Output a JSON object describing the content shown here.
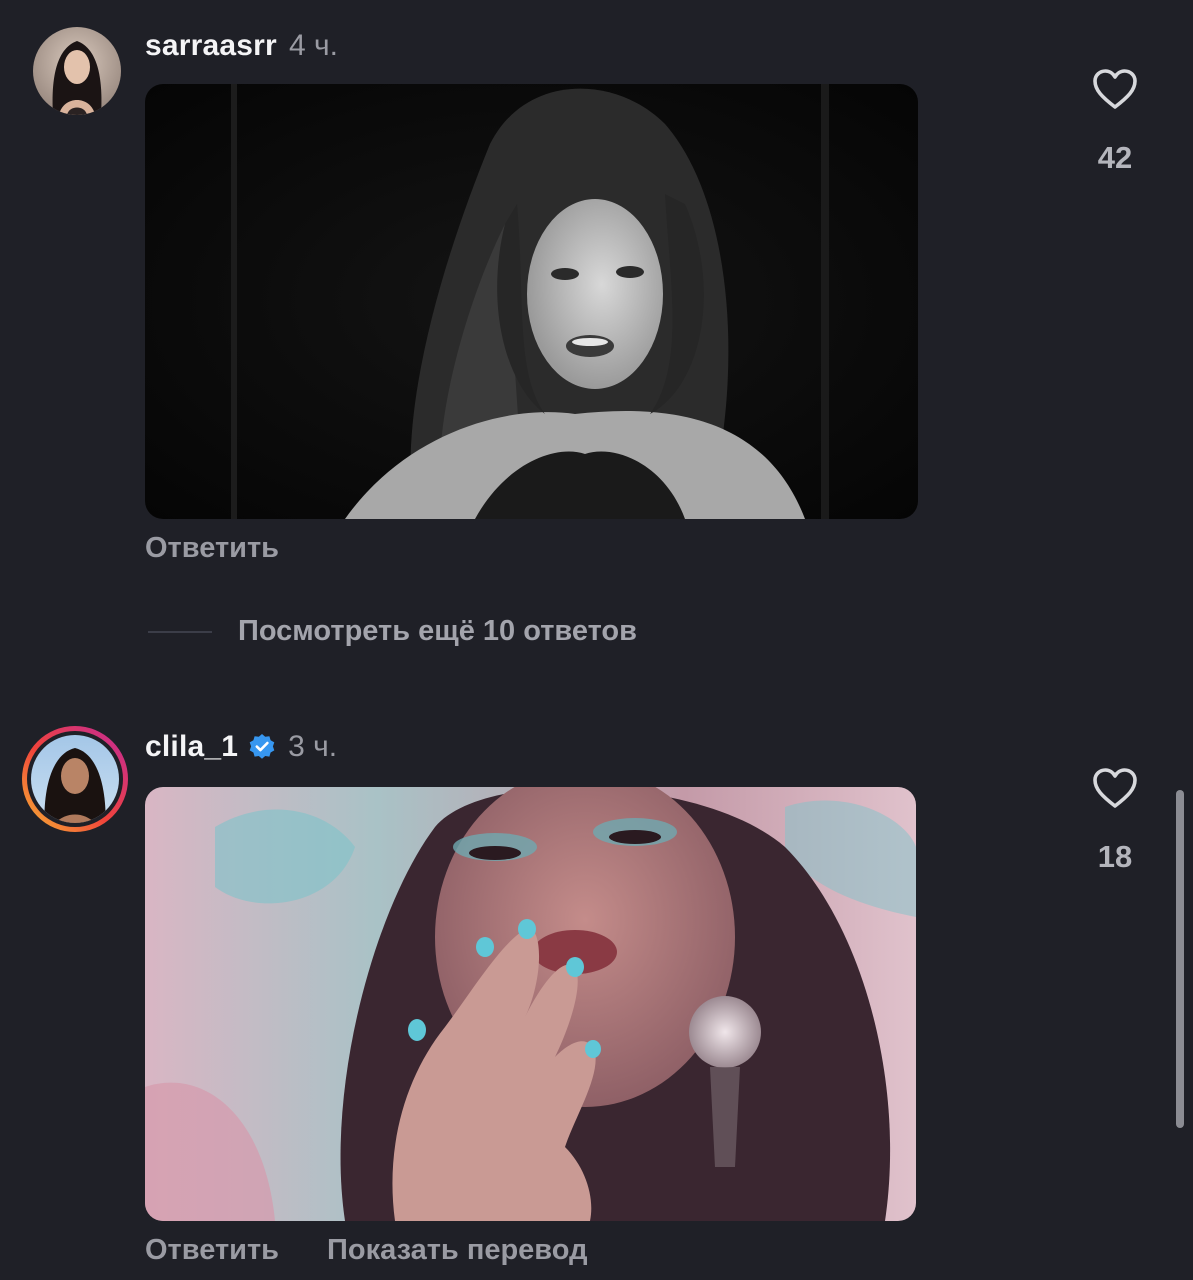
{
  "comments": [
    {
      "username": "sarraasrr",
      "time": "4 ч.",
      "verified": false,
      "likes": "42",
      "reply_label": "Ответить"
    },
    {
      "username": "clila_1",
      "time": "3 ч.",
      "verified": true,
      "likes": "18",
      "reply_label": "Ответить",
      "translate_label": "Показать перевод"
    }
  ],
  "view_more_replies": "Посмотреть ещё 10 ответов",
  "colors": {
    "background": "#1f2027",
    "muted_text": "#9a9ba3",
    "verified_blue": "#3797f0"
  },
  "icons": {
    "like": "heart-outline-icon",
    "verified": "verified-badge-icon"
  }
}
